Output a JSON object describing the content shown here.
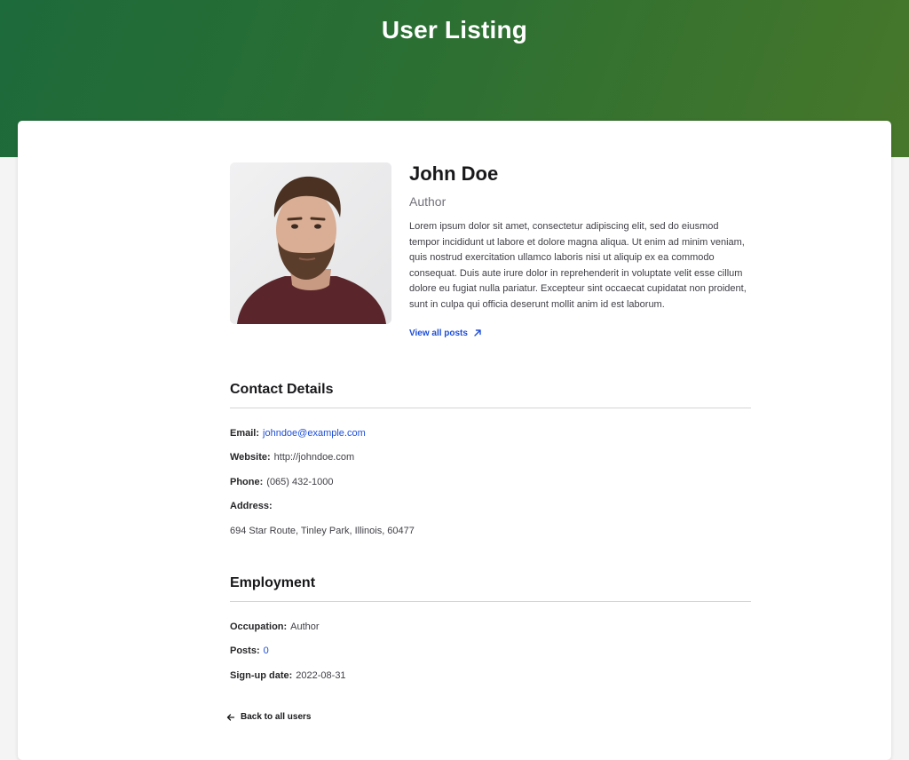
{
  "header": {
    "title": "User Listing"
  },
  "profile": {
    "name": "John Doe",
    "role": "Author",
    "bio": "Lorem ipsum dolor sit amet, consectetur adipiscing elit, sed do eiusmod tempor incididunt ut labore et dolore magna aliqua. Ut enim ad minim veniam, quis nostrud exercitation ullamco laboris nisi ut aliquip ex ea commodo consequat. Duis aute irure dolor in reprehenderit in voluptate velit esse cillum dolore eu fugiat nulla pariatur. Excepteur sint occaecat cupidatat non proident, sunt in culpa qui officia deserunt mollit anim id est laborum.",
    "view_posts_label": "View all posts",
    "view_posts_icon": "arrow-up-right-icon"
  },
  "contact": {
    "title": "Contact Details",
    "email_label": "Email:",
    "email_value": "johndoe@example.com",
    "website_label": "Website:",
    "website_value": "http://johndoe.com",
    "phone_label": "Phone:",
    "phone_value": "(065) 432-1000",
    "address_label": "Address:",
    "address_value": "694 Star Route, Tinley Park, Illinois, 60477"
  },
  "employment": {
    "title": "Employment",
    "occupation_label": "Occupation:",
    "occupation_value": "Author",
    "posts_label": "Posts:",
    "posts_value": "0",
    "signup_label": "Sign-up date:",
    "signup_value": "2022-08-31"
  },
  "footer": {
    "back_label": "Back to all users",
    "back_icon": "arrow-left-icon"
  },
  "colors": {
    "hero_start": "#1d6a3a",
    "hero_end": "#47772a",
    "link": "#1d4ed8"
  }
}
